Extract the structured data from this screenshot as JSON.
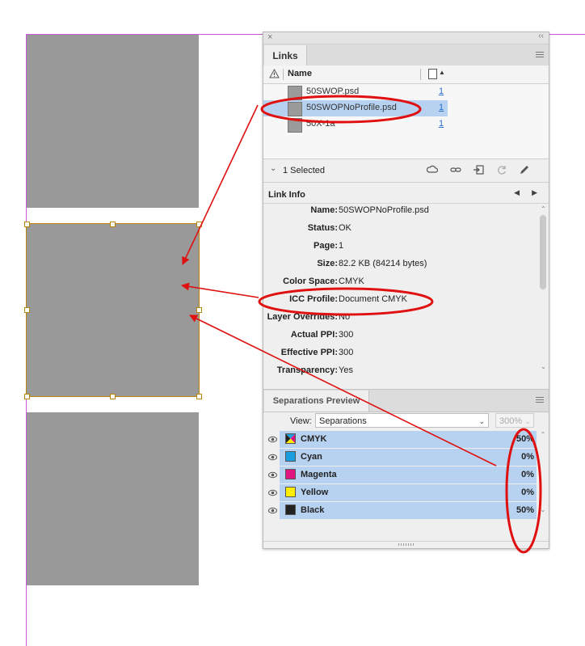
{
  "links_panel": {
    "tab_label": "Links",
    "column_name": "Name",
    "items": [
      {
        "name": "50SWOP.psd",
        "page": "1",
        "selected": false
      },
      {
        "name": "50SWOPNoProfile.psd",
        "page": "1",
        "selected": true
      },
      {
        "name": "50X-1a",
        "page": "1",
        "selected": false
      }
    ],
    "selected_count": "1 Selected",
    "toolbar_icons": [
      "cloud-link-icon",
      "relink-icon",
      "goto-link-icon",
      "update-link-icon",
      "edit-original-icon"
    ]
  },
  "link_info": {
    "title": "Link Info",
    "rows": [
      {
        "label": "Name:",
        "value": "50SWOPNoProfile.psd"
      },
      {
        "label": "Status:",
        "value": "OK"
      },
      {
        "label": "Page:",
        "value": "1"
      },
      {
        "label": "Size:",
        "value": "82.2 KB (84214 bytes)"
      },
      {
        "label": "Color Space:",
        "value": "CMYK"
      },
      {
        "label": "ICC Profile:",
        "value": "Document CMYK"
      },
      {
        "label": "Layer Overrides:",
        "value": "No"
      },
      {
        "label": "Actual PPI:",
        "value": "300"
      },
      {
        "label": "Effective PPI:",
        "value": "300"
      },
      {
        "label": "Transparency:",
        "value": "Yes"
      }
    ]
  },
  "separations": {
    "tab_label": "Separations Preview",
    "view_label": "View:",
    "view_value": "Separations",
    "zoom_value": "300%",
    "rows": [
      {
        "name": "CMYK",
        "percent": "50%",
        "color": "cmyk"
      },
      {
        "name": "Cyan",
        "percent": "0%",
        "color": "#1a9ee0"
      },
      {
        "name": "Magenta",
        "percent": "0%",
        "color": "#e0157f"
      },
      {
        "name": "Yellow",
        "percent": "0%",
        "color": "#ffee00"
      },
      {
        "name": "Black",
        "percent": "50%",
        "color": "#222222"
      }
    ]
  },
  "colors": {
    "selection_blue": "#b7d2f0",
    "annotation_red": "#e01010",
    "frame_gray": "#999999",
    "guide_magenta": "#c85ad6"
  }
}
